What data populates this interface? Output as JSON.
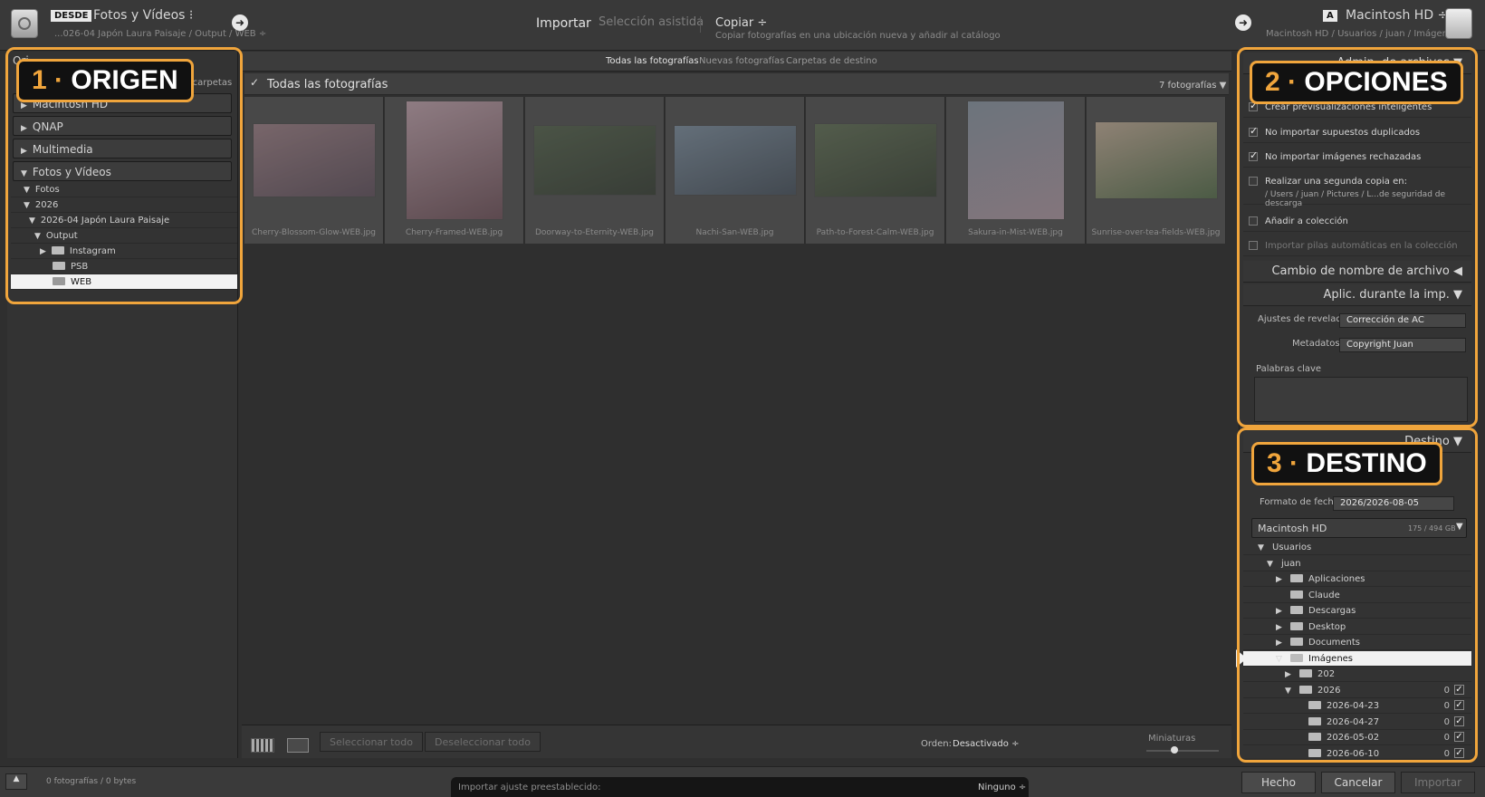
{
  "header": {
    "source_badge": "DESDE",
    "source_title": "Fotos y Vídeos ⁝",
    "source_path": "...026-04 Japón Laura Paisaje / Output / WEB ÷",
    "mode_import": "Importar",
    "mode_assisted": "Selección asistida",
    "mode_copy": "Copiar ÷",
    "mode_copy_desc": "Copiar fotografías en una ubicación nueva y añadir al catálogo",
    "dest_letter": "A",
    "dest_title": "Macintosh HD ÷",
    "dest_path": "Macintosh HD / Usuarios / juan / Imágenes",
    "arrow": "➜"
  },
  "left": {
    "header_partial": "Ori",
    "subfolders": "ubcarpetas",
    "macintosh_partial": "Macintosh HD",
    "volumes": [
      "QNAP",
      "Multimedia",
      "Fotos y Vídeos"
    ],
    "tree": [
      "Fotos",
      "2026",
      "2026-04 Japón Laura Paisaje",
      "Output",
      "Instagram",
      "PSB",
      "WEB"
    ]
  },
  "filters": [
    "Todas las fotografías",
    "Nuevas fotografías",
    "Carpetas de destino"
  ],
  "grid": {
    "title": "Todas las fotografías",
    "count": "7 fotografías ▼",
    "photos": [
      {
        "name": "Cherry-Blossom-Glow-WEB.jpg",
        "c1": "#a07f87",
        "c2": "#5c4a58"
      },
      {
        "name": "Cherry-Framed-WEB.jpg",
        "c1": "#c9a7b3",
        "c2": "#6d4b55"
      },
      {
        "name": "Doorway-to-Eternity-WEB.jpg",
        "c1": "#4d5e45",
        "c2": "#2c3529"
      },
      {
        "name": "Nachi-San-WEB.jpg",
        "c1": "#7b8fa2",
        "c2": "#3f4b58"
      },
      {
        "name": "Path-to-Forest-Calm-WEB.jpg",
        "c1": "#5c6d4f",
        "c2": "#2f3a2a"
      },
      {
        "name": "Sakura-in-Mist-WEB.jpg",
        "c1": "#8a99a8",
        "c2": "#b59aa8"
      },
      {
        "name": "Sunrise-over-tea-fields-WEB.jpg",
        "c1": "#c9b29a",
        "c2": "#4f6b43"
      }
    ]
  },
  "toolbar": {
    "select_all": "Seleccionar todo",
    "deselect_all": "Deseleccionar todo",
    "order_label": "Orden:",
    "order_value": "Desactivado ÷",
    "thumbs_label": "Miniaturas"
  },
  "right": {
    "file_handling_partial": "Admin. de archivos ▼",
    "previews_partial": "Crear previsualizaciones inteligentes",
    "opt_dup": "No importar supuestos duplicados",
    "opt_rej": "No importar imágenes rechazadas",
    "opt_second": "Realizar una segunda copia en:",
    "opt_second_path": "/ Users / juan / Pictures / L...de seguridad de descarga",
    "opt_collection": "Añadir a colección",
    "opt_stacks": "Importar pilas automáticas en la colección",
    "sec_rename": "Cambio de nombre de archivo ◀",
    "sec_apply": "Aplic. durante la imp. ▼",
    "develop_label": "Ajustes de revelado",
    "develop_value": "Corrección de AC",
    "meta_label": "Metadatos",
    "meta_value": "Copyright Juan",
    "keywords_label": "Palabras clave",
    "dest_header_partial": "Destino ▼",
    "date_label": "Formato de fecha",
    "date_value": "2026/2026-08-05",
    "volume_name": "Macintosh HD",
    "volume_space": "175 / 494 GB",
    "dest_tree": [
      {
        "label": "Usuarios",
        "indent": 1,
        "tri": "▼"
      },
      {
        "label": "juan",
        "indent": 2,
        "tri": "▼"
      },
      {
        "label": "Aplicaciones",
        "indent": 3,
        "tri": "▶",
        "folder": true
      },
      {
        "label": "Claude",
        "indent": 3,
        "tri": "",
        "folder": true
      },
      {
        "label": "Descargas",
        "indent": 3,
        "tri": "▶",
        "folder": true
      },
      {
        "label": "Desktop",
        "indent": 3,
        "tri": "▶",
        "folder": true
      },
      {
        "label": "Documents",
        "indent": 3,
        "tri": "▶",
        "folder": true
      },
      {
        "label": "Imágenes",
        "indent": 3,
        "tri": "▽",
        "folder": true,
        "sel": true
      },
      {
        "label": "202",
        "indent": 4,
        "tri": "▶",
        "folder": true
      },
      {
        "label": "2026",
        "indent": 4,
        "tri": "▼",
        "folder": true,
        "count": "0",
        "check": "✓"
      },
      {
        "label": "2026-04-23",
        "indent": 5,
        "tri": "",
        "folder": true,
        "count": "0",
        "check": "✓"
      },
      {
        "label": "2026-04-27",
        "indent": 5,
        "tri": "",
        "folder": true,
        "count": "0",
        "check": "✓"
      },
      {
        "label": "2026-05-02",
        "indent": 5,
        "tri": "",
        "folder": true,
        "count": "0",
        "check": "✓"
      },
      {
        "label": "2026-06-10",
        "indent": 5,
        "tri": "",
        "folder": true,
        "count": "0",
        "check": "✓"
      }
    ]
  },
  "footer": {
    "status": "0 fotografías / 0 bytes",
    "preset_label": "Importar ajuste preestablecido:",
    "preset_value": "Ninguno ÷",
    "done": "Hecho",
    "cancel": "Cancelar",
    "import": "Importar"
  },
  "callouts": {
    "c1_num": "1",
    "c1_text": "ORIGEN",
    "c2_num": "2",
    "c2_text": "OPCIONES",
    "c3_num": "3",
    "c3_text": "DESTINO",
    "dot": "·"
  },
  "colors": {
    "accent": "#f0a53c",
    "panel": "#333333"
  }
}
